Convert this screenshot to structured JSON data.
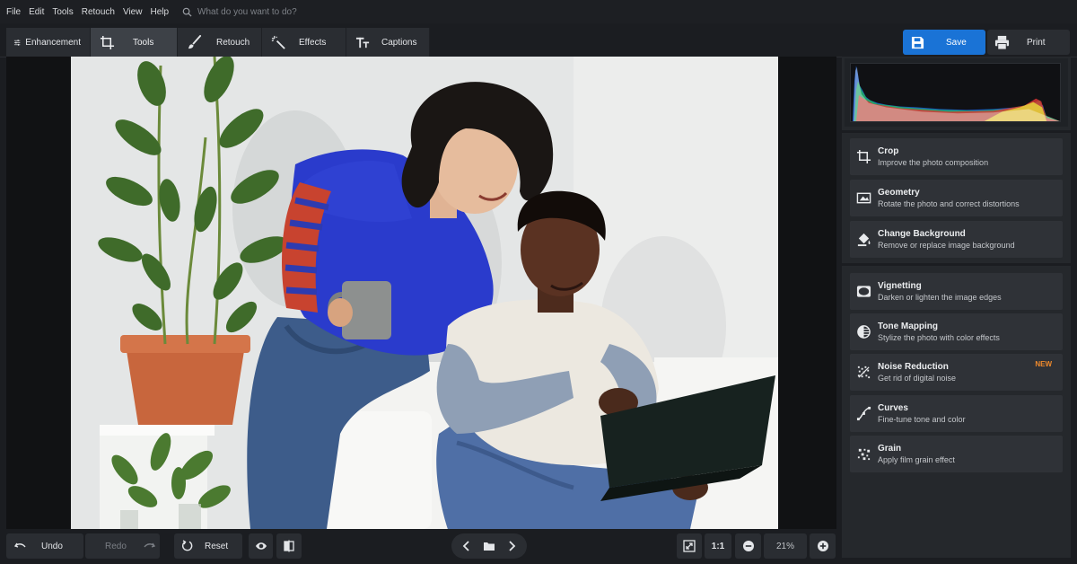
{
  "menu": {
    "items": [
      "File",
      "Edit",
      "Tools",
      "Retouch",
      "View",
      "Help"
    ],
    "search_placeholder": "What do you want to do?"
  },
  "tabs": [
    {
      "label": "Enhancement",
      "icon": "sliders-icon",
      "active": false
    },
    {
      "label": "Tools",
      "icon": "crop-icon",
      "active": true
    },
    {
      "label": "Retouch",
      "icon": "brush-icon",
      "active": false
    },
    {
      "label": "Effects",
      "icon": "magic-wand-icon",
      "active": false
    },
    {
      "label": "Captions",
      "icon": "text-tt-icon",
      "active": false
    }
  ],
  "actions": {
    "save_label": "Save",
    "print_label": "Print"
  },
  "tools": [
    {
      "title": "Crop",
      "desc": "Improve the photo composition",
      "icon": "crop-icon"
    },
    {
      "title": "Geometry",
      "desc": "Rotate the photo and correct distortions",
      "icon": "geometry-icon"
    },
    {
      "title": "Change Background",
      "desc": "Remove or replace image background",
      "icon": "paint-bucket-icon"
    },
    {
      "title": "Vignetting",
      "desc": "Darken or lighten the image edges",
      "icon": "vignette-icon"
    },
    {
      "title": "Tone Mapping",
      "desc": "Stylize the photo with color effects",
      "icon": "tone-mapping-icon"
    },
    {
      "title": "Noise Reduction",
      "desc": "Get rid of digital noise",
      "icon": "noise-icon",
      "badge": "NEW"
    },
    {
      "title": "Curves",
      "desc": "Fine-tune tone and color",
      "icon": "curves-icon"
    },
    {
      "title": "Grain",
      "desc": "Apply film grain effect",
      "icon": "grain-icon"
    }
  ],
  "bottom": {
    "undo_label": "Undo",
    "redo_label": "Redo",
    "reset_label": "Reset",
    "one_to_one_label": "1:1",
    "zoom_value": "21%"
  },
  "colors": {
    "accent": "#1a73d6",
    "badge": "#f08a2c",
    "background": "#1b1d21",
    "panel": "#25282c"
  }
}
